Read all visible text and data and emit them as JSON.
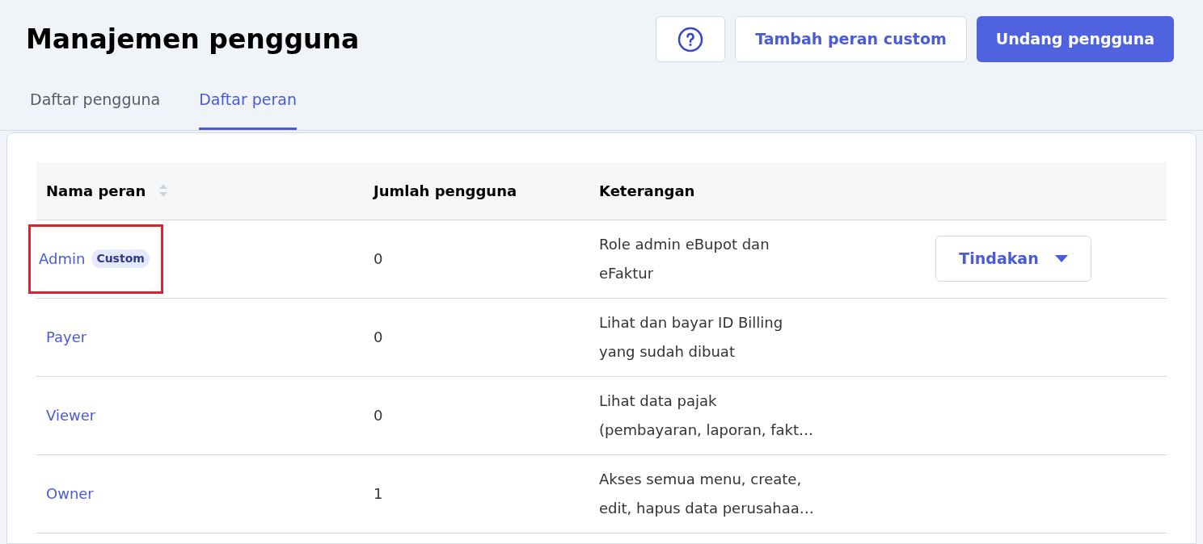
{
  "title": "Manajemen pengguna",
  "header_buttons": [
    {
      "kind": "help"
    },
    {
      "kind": "secondary",
      "label": "Tambah peran custom"
    },
    {
      "kind": "primary",
      "label": "Undang pengguna"
    }
  ],
  "tabs": [
    {
      "label": "Daftar pengguna",
      "selected": false
    },
    {
      "label": "Daftar peran",
      "selected": true
    }
  ],
  "table": {
    "columns": [
      "Nama peran",
      "Jumlah pengguna",
      "Keterangan"
    ],
    "rows": [
      {
        "name": "Admin",
        "badge": "Custom",
        "highlighted": true,
        "count": "0",
        "description": [
          "Role admin eBupot dan",
          "eFaktur"
        ],
        "action": "Tindakan"
      },
      {
        "name": "Payer",
        "highlighted": false,
        "count": "0",
        "description": [
          "Lihat dan bayar ID Billing",
          "yang sudah dibuat"
        ]
      },
      {
        "name": "Viewer",
        "highlighted": false,
        "count": "0",
        "description": [
          "Lihat data pajak",
          "(pembayaran, laporan, fakt…"
        ]
      },
      {
        "name": "Owner",
        "highlighted": false,
        "count": "1",
        "description": [
          "Akses semua menu, create,",
          "edit, hapus data perusahaa…"
        ]
      }
    ]
  }
}
